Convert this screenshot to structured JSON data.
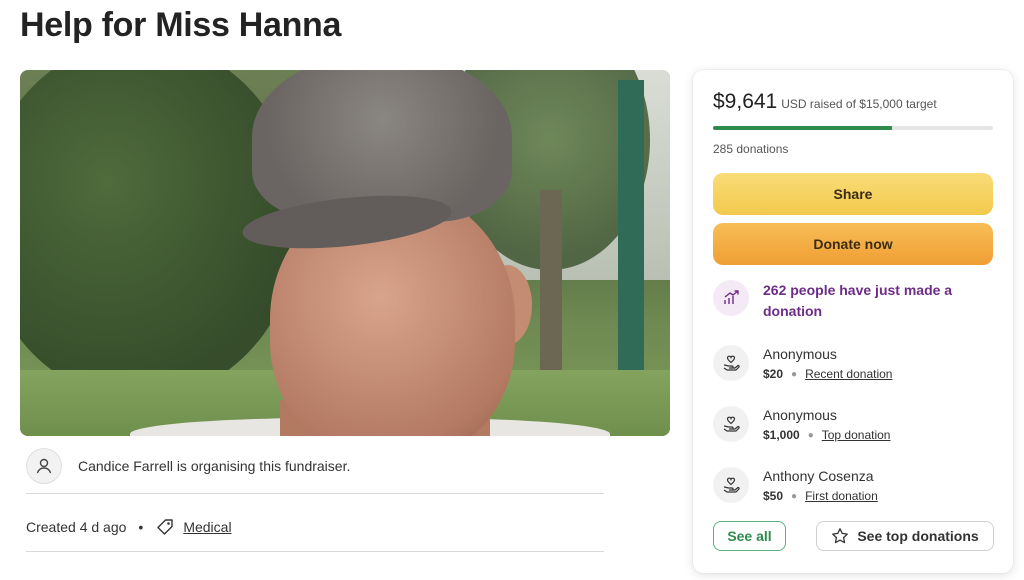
{
  "page": {
    "title": "Help for Miss Hanna"
  },
  "organiser": {
    "text": "Candice Farrell is organising this fundraiser."
  },
  "meta": {
    "created": "Created 4 d ago",
    "separator": "•",
    "category": "Medical"
  },
  "card": {
    "amount": "$9,641",
    "amount_sub": "USD raised of $15,000 target",
    "progress_fraction": 0.64,
    "donation_count": "285 donations",
    "share_label": "Share",
    "donate_label": "Donate now",
    "activity_text": "262 people have just made a donation",
    "donors": [
      {
        "name": "Anonymous",
        "amount": "$20",
        "tag": "Recent donation"
      },
      {
        "name": "Anonymous",
        "amount": "$1,000",
        "tag": "Top donation"
      },
      {
        "name": "Anthony Cosenza",
        "amount": "$50",
        "tag": "First donation"
      }
    ],
    "see_all_label": "See all",
    "see_top_label": "See top donations"
  },
  "colors": {
    "accent_green": "#2f8b4d",
    "purple": "#6e2c86",
    "share_yellow": "#f2c94c",
    "donate_orange": "#ef9f34"
  },
  "icons": [
    "user-icon",
    "tag-icon",
    "trending-up-icon",
    "heart-hand-icon",
    "star-icon"
  ]
}
